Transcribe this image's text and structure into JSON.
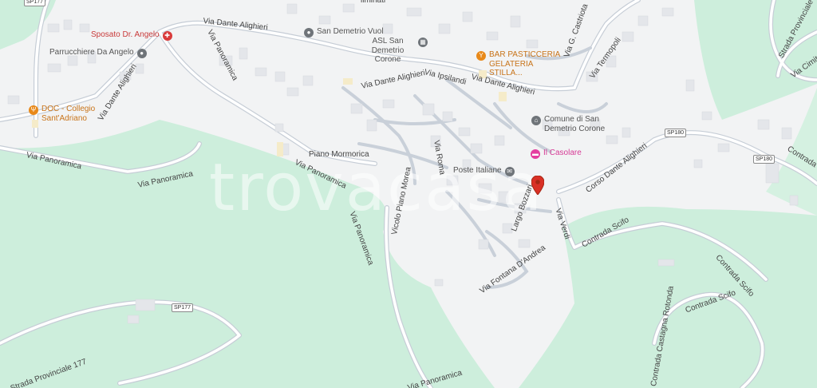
{
  "watermark": "trovacasa",
  "roads": {
    "dante_1": "Via Dante Alighieri",
    "dante_2": "Via Dante Alighieri",
    "dante_3": "Via Dante Alighieri",
    "dante_4": "Via Dante Alighieri",
    "panoramica_1": "Via Panoramica",
    "panoramica_2": "Via Panoramica",
    "panoramica_3": "Via Panoramica",
    "panoramica_4": "Via Panoramica",
    "panoramica_5": "Via Panoramica",
    "panoramica_6": "Via Panoramica",
    "ipsilandi": "Via Ipsilandi",
    "castriota": "Via G. Castriota",
    "termopoli": "Via Termopoli",
    "mormorica": "Piano Mormorica",
    "roma": "Via Roma",
    "vicolo_morea": "Vicolo Piano Morea",
    "bozzari": "Largo Bozzari",
    "verdi": "Via Verdi",
    "fontana": "Via Fontana D'Andrea",
    "corso_dante": "Corso Dante Alighieri",
    "scifo_1": "Contrada Scifo",
    "scifo_2": "Contrada Scifo",
    "scifo_3": "Contrada Scifo",
    "castagna": "Contrada Castagna Rotonda",
    "strada_provinciale": "Strada Provinciale",
    "cimitero": "Via Cimitero",
    "contrada_p": "Contrada P",
    "sp177": "Strada Provinciale 177"
  },
  "shields": {
    "sp177_top": "SP177",
    "sp177_bottom": "SP177",
    "sp180_a": "SP180",
    "sp180_b": "SP180"
  },
  "pois": {
    "sposato": {
      "name": "Sposato Dr. Angelo",
      "icon": "medical-cross-icon",
      "color": "#d93b3b"
    },
    "parrucchiere": {
      "name": "Parrucchiere Da Angelo",
      "icon": "shop-pin-icon",
      "color": "#5f6368"
    },
    "doc": {
      "name": "DOC - Collegio Sant'Adriano",
      "icon": "restaurant-icon",
      "color": "#e8891a"
    },
    "sandemetrio": {
      "name": "San Demetrio Vuol",
      "icon": "place-pin-icon",
      "color": "#5f6368"
    },
    "asl": {
      "name": "ASL San Demetrio Corone",
      "icon": "building-icon",
      "color": "#5f6368"
    },
    "bar": {
      "name": "BAR PASTICCERIA GELATERIA STILLA...",
      "icon": "cocktail-icon",
      "color": "#e8891a"
    },
    "comune": {
      "name": "Comune di San Demetrio Corone",
      "icon": "town-hall-icon",
      "color": "#5f6368"
    },
    "casolare": {
      "name": "Il Casolare",
      "icon": "hotel-bed-icon",
      "color": "#e43ea0"
    },
    "poste": {
      "name": "Poste Italiane",
      "icon": "mail-icon",
      "color": "#5f6368"
    }
  },
  "top_cut_label": "liminati"
}
